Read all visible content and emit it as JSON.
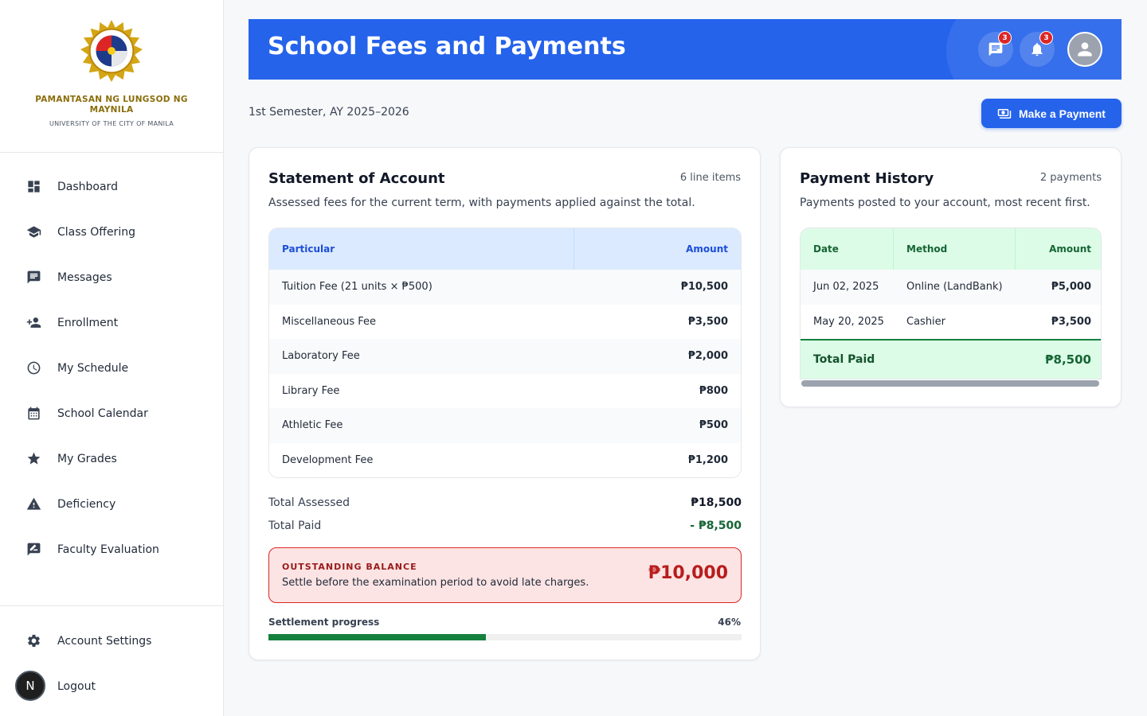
{
  "sidebar": {
    "university_name": "PAMANTASAN NG LUNGSOD NG MAYNILA",
    "university_sub": "UNIVERSITY OF THE CITY OF MANILA",
    "items": [
      {
        "label": "Dashboard",
        "icon": "dashboard-icon"
      },
      {
        "label": "Class Offering",
        "icon": "graduation-cap-icon"
      },
      {
        "label": "Messages",
        "icon": "message-icon"
      },
      {
        "label": "Enrollment",
        "icon": "person-add-icon"
      },
      {
        "label": "My Schedule",
        "icon": "clock-icon"
      },
      {
        "label": "School Calendar",
        "icon": "calendar-icon"
      },
      {
        "label": "My Grades",
        "icon": "star-icon"
      },
      {
        "label": "Deficiency",
        "icon": "warning-icon"
      },
      {
        "label": "Faculty Evaluation",
        "icon": "rate-review-icon"
      }
    ],
    "bottom_items": [
      {
        "label": "Account Settings",
        "icon": "gear-icon"
      },
      {
        "label": "Logout",
        "icon": "logout-icon"
      }
    ],
    "avatar_letter": "N"
  },
  "header": {
    "title": "School Fees and Payments",
    "messages_badge": "3",
    "notifications_badge": "3",
    "accent": "#2563eb"
  },
  "semester": "1st Semester, AY 2025–2026",
  "make_payment_label": "Make a Payment",
  "statement": {
    "title": "Statement of Account",
    "count": "6 line items",
    "description": "Assessed fees for the current term, with payments applied against the total.",
    "columns": [
      "Particular",
      "Amount"
    ],
    "rows": [
      {
        "particular": "Tuition Fee (21 units × ₱500)",
        "amount": "₱10,500"
      },
      {
        "particular": "Miscellaneous Fee",
        "amount": "₱3,500"
      },
      {
        "particular": "Laboratory Fee",
        "amount": "₱2,000"
      },
      {
        "particular": "Library Fee",
        "amount": "₱800"
      },
      {
        "particular": "Athletic Fee",
        "amount": "₱500"
      },
      {
        "particular": "Development Fee",
        "amount": "₱1,200"
      }
    ],
    "total_assessed_label": "Total Assessed",
    "total_assessed": "₱18,500",
    "total_paid_label": "Total Paid",
    "total_paid": "- ₱8,500",
    "balance_label": "OUTSTANDING BALANCE",
    "balance_note": "Settle before the examination period to avoid late charges.",
    "balance_amount": "₱10,000",
    "progress_label": "Settlement progress",
    "progress_text": "46%",
    "progress_value": 46
  },
  "history": {
    "title": "Payment History",
    "count": "2 payments",
    "description": "Payments posted to your account, most recent first.",
    "columns": [
      "Date",
      "Method",
      "Amount"
    ],
    "rows": [
      {
        "date": "Jun 02, 2025",
        "method": "Online (LandBank)",
        "amount": "₱5,000"
      },
      {
        "date": "May 20, 2025",
        "method": "Cashier",
        "amount": "₱3,500"
      }
    ],
    "total_label": "Total Paid",
    "total": "₱8,500"
  }
}
